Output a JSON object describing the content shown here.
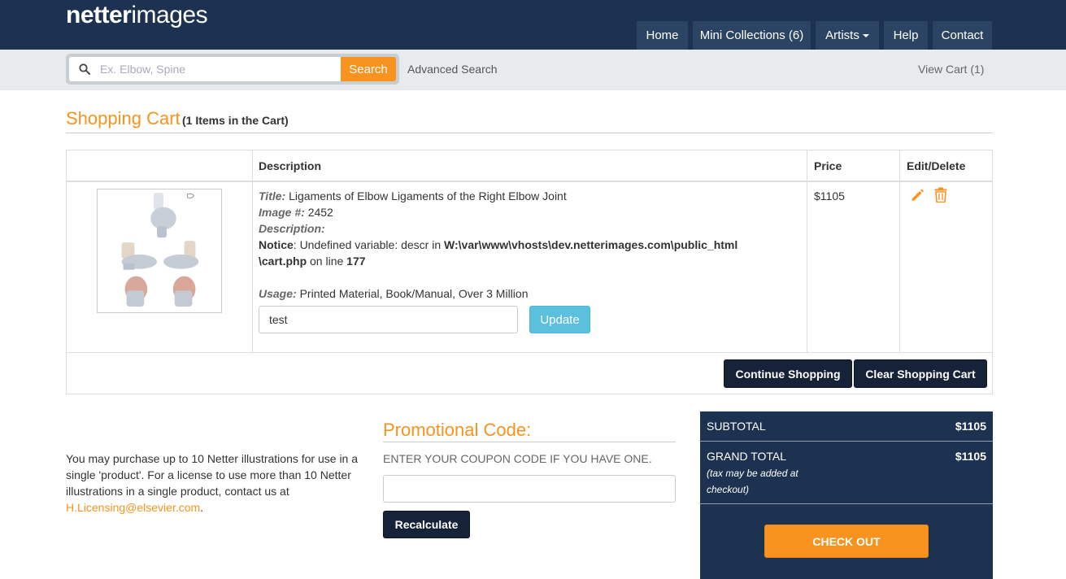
{
  "header": {
    "logo_bold": "netter",
    "logo_light": "images",
    "nav": [
      {
        "label": "Home"
      },
      {
        "label": "Mini Collections (6)"
      },
      {
        "label": "Artists"
      },
      {
        "label": "Help"
      },
      {
        "label": "Contact"
      }
    ]
  },
  "search": {
    "placeholder": "Ex. Elbow, Spine",
    "button_label": "Search",
    "advanced_label": "Advanced Search",
    "view_cart_label": "View Cart (1)"
  },
  "cart": {
    "title": "Shopping Cart",
    "count_text": "(1 Items in the Cart)",
    "columns": {
      "description": "Description",
      "price": "Price",
      "edit_delete": "Edit/Delete"
    },
    "item": {
      "title_label": "Title:",
      "title_value": "Ligaments of Elbow Ligaments of the Right Elbow Joint",
      "image_label": "Image #:",
      "image_value": "2452",
      "description_label": "Description:",
      "notice_label": "Notice",
      "notice_text": ": Undefined variable: descr in ",
      "notice_path1": "W:\\var\\www\\vhosts\\dev.netterimages.com\\public_html",
      "notice_path2": "\\cart.php",
      "notice_on_line": " on line ",
      "notice_line": "177",
      "usage_label": "Usage:",
      "usage_value": "Printed Material, Book/Manual, Over 3 Million",
      "note_value": "test",
      "update_label": "Update",
      "price": "$1105"
    },
    "continue_label": "Continue Shopping",
    "clear_label": "Clear Shopping Cart"
  },
  "info": {
    "text": "You may purchase up to 10 Netter illustrations for use in a single 'product'. For a license to use more than 10 Netter illustrations in a single product, contact us at ",
    "email": "H.Licensing@elsevier.com",
    "trailing": "."
  },
  "promo": {
    "title": "Promotional Code:",
    "subtitle": "ENTER YOUR COUPON CODE IF YOU HAVE ONE.",
    "input_value": "",
    "recalc_label": "Recalculate"
  },
  "totals": {
    "subtotal_label": "SUBTOTAL",
    "subtotal_value": "$1105",
    "grand_label": "GRAND TOTAL",
    "grand_value": "$1105",
    "tax_note": "(tax may be added at checkout)",
    "checkout_label": "CHECK OUT"
  },
  "colors": {
    "navy": "#1c3250",
    "nav_item": "#2b4463",
    "orange": "#f7931e",
    "info_blue": "#5bc0de",
    "dark_button": "#152238"
  },
  "icons": [
    "search-icon",
    "caret-down-icon",
    "pencil-icon",
    "trash-icon"
  ]
}
